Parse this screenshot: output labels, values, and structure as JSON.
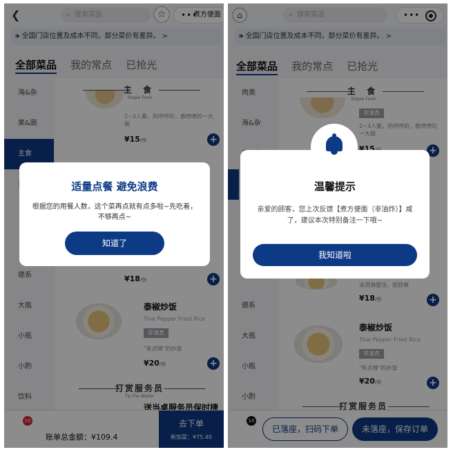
{
  "colors": {
    "brand": "#0d3a85",
    "badge": "#d0263a"
  },
  "left": {
    "search_placeholder": "搜索菜品",
    "capsule_text": "煮方便面",
    "notice": "全国门店位置及成本不同，部分菜价有差异。 >",
    "tabs": [
      "全部菜品",
      "我的常点",
      "已抢光"
    ],
    "sidebar": [
      "海&杂",
      "果&蔬",
      "主食",
      "打",
      "德系",
      "大瓶",
      "小瓶",
      "小酌",
      "饮料"
    ],
    "section_staple": {
      "cn": "主 食",
      "en": "Staple Food"
    },
    "item1": {
      "desc": "2~3人量，热呼呼的，香喷喷的一大碗",
      "price": "¥15",
      "unit": "/份"
    },
    "price2": {
      "price": "¥18",
      "unit": "/份"
    },
    "thai": {
      "name": "泰椒炒饭",
      "en": "Thai Pepper Fried Rice",
      "tag": "非清真",
      "note": "\"有点辣\"的炒饭",
      "price": "¥20",
      "unit": "/份"
    },
    "section_tip": {
      "cn": "打赏服务员",
      "en": "Tip the Waiter"
    },
    "partial_item": "送当桌服务员保时捷",
    "badge": "10",
    "total": "账单总金额：¥109.4",
    "order_main": "去下单",
    "order_sub": "新加菜：¥75.40",
    "modal": {
      "title": "适量点餐 避免浪费",
      "body": "根据您的用餐人数，这个菜再点就有点多啦~先吃着，不够再点~",
      "button": "知道了"
    }
  },
  "right": {
    "search_placeholder": "搜索菜品",
    "notice": "全国门店位置及成本不同，部分菜价有差异。 >",
    "tabs": [
      "全部菜品",
      "我的常点",
      "已抢光"
    ],
    "sidebar": [
      "肉类",
      "海&杂",
      "果&蔬",
      "打",
      "德系",
      "大瓶",
      "小瓶",
      "小酌"
    ],
    "section_staple": {
      "cn": "主 食",
      "en": "Staple Food"
    },
    "item1": {
      "tag": "非清真",
      "desc": "2~3人量，热呼呼的，香喷喷的一大碗",
      "price": "¥15",
      "unit": "/份"
    },
    "item2": {
      "desc": "冰淇淋甜汤，很舒爽",
      "price": "¥18",
      "unit": "/份"
    },
    "thai": {
      "name": "泰椒炒饭",
      "en": "Thai Pepper Fried Rice",
      "tag": "非清真",
      "note": "\"有点辣\"的炒饭",
      "price": "¥20",
      "unit": "/份"
    },
    "section_tip": {
      "cn": "打赏服务员"
    },
    "badge": "10",
    "btn_seated": "已落座，扫码下单",
    "btn_save": "未落座，保存订单",
    "modal": {
      "title": "温馨提示",
      "body": "亲爱的顾客，您上次反馈【煮方便面（非油炸）】咸了，建议本次特别备注一下哦~",
      "button": "我知道啦"
    }
  }
}
